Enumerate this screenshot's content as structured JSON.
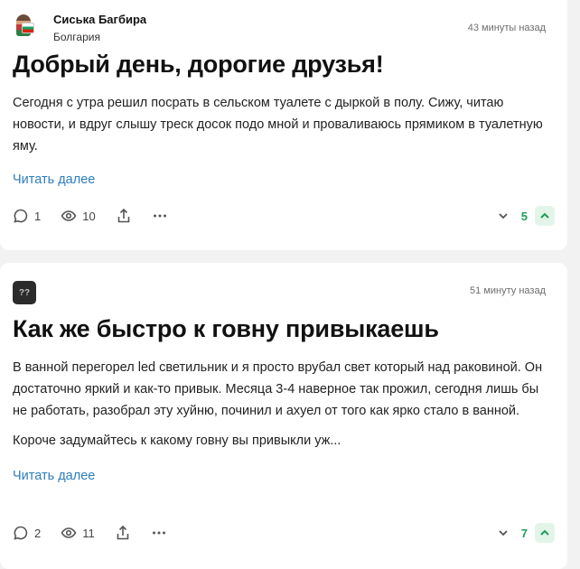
{
  "posts": [
    {
      "author": {
        "name": "Сиська Багбира",
        "subtitle": "Болгария",
        "avatar": "character-with-bulgarian-flag"
      },
      "time": "43 минуты назад",
      "title": "Добрый день, дорогие друзья!",
      "paragraphs": [
        "Сегодня с утра решил посрать в сельском туалете с дыркой в полу. Сижу, читаю новости, и вдруг слышу треск досок подо мной и проваливаюсь прямиком в туалетную яму."
      ],
      "read_more": "Читать далее",
      "comments": "1",
      "views": "10",
      "rating": "5"
    },
    {
      "author": {
        "avatar_text": "??",
        "avatar": "anonymous-avatar"
      },
      "time": "51 минуту назад",
      "title": "Как же быстро к говну привыкаешь",
      "paragraphs": [
        "В ванной перегорел led светильник и я просто врубал свет который над раковиной. Он достаточно яркий и как-то привык. Месяца 3-4 наверное так прожил, сегодня лишь бы не работать, разобрал эту хуйню, починил и ахуел от того как ярко стало в ванной.",
        "Короче задумайтесь к какому говну вы привыкли уж..."
      ],
      "read_more": "Читать далее",
      "comments": "2",
      "views": "11",
      "rating": "7"
    }
  ],
  "colors": {
    "accent_link": "#2d7dbd",
    "rating_positive": "#1f9d55",
    "upvote_bg": "#e3f5e8"
  }
}
